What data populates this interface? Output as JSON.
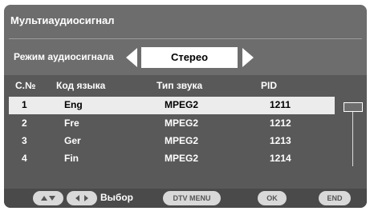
{
  "title": "Мультиаудиосигнал",
  "mode": {
    "label": "Режим аудиосигнала",
    "value": "Стерео"
  },
  "table": {
    "headers": [
      "С.№",
      "Код языка",
      "Тип звука",
      "PID"
    ],
    "rows": [
      {
        "num": "1",
        "lang": "Eng",
        "type": "MPEG2",
        "pid": "1211"
      },
      {
        "num": "2",
        "lang": "Fre",
        "type": "MPEG2",
        "pid": "1212"
      },
      {
        "num": "3",
        "lang": "Ger",
        "type": "MPEG2",
        "pid": "1213"
      },
      {
        "num": "4",
        "lang": "Fin",
        "type": "MPEG2",
        "pid": "1214"
      }
    ],
    "selected_index": 0
  },
  "footer": {
    "select_label": "Выбор",
    "dtv_menu_label": "DTV MENU",
    "ok_label": "OK",
    "end_label": "END"
  },
  "colors": {
    "panel": "#6d6d6d",
    "table_bg": "#595959",
    "footer_bg": "#4a4a4a",
    "selected_row": "#ececec",
    "button": "#d9d9d9"
  },
  "icons": [
    "left-arrow-icon",
    "right-arrow-icon",
    "up-down-arrows-icon",
    "left-right-arrows-icon"
  ]
}
